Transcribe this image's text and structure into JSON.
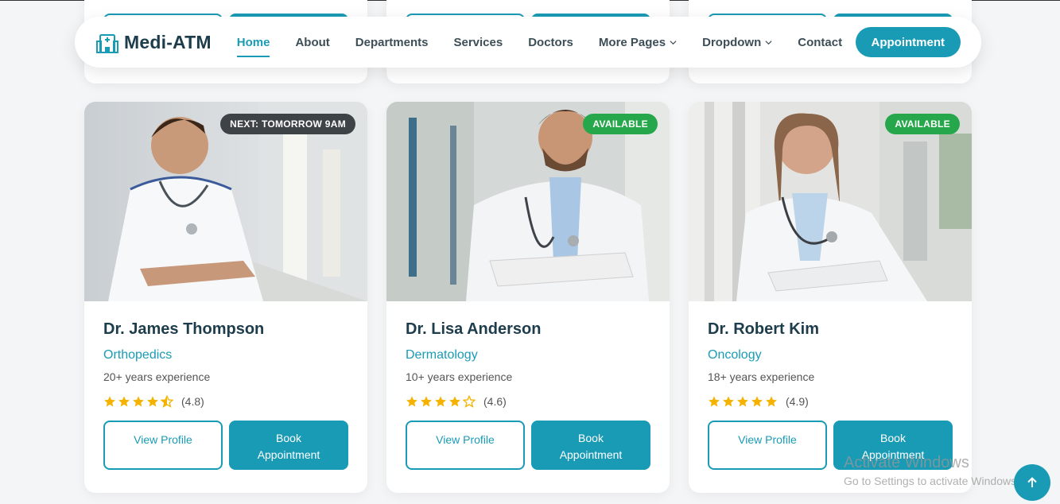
{
  "brand": {
    "name": "Medi-ATM"
  },
  "nav": {
    "items": [
      {
        "label": "Home",
        "active": true
      },
      {
        "label": "About"
      },
      {
        "label": "Departments"
      },
      {
        "label": "Services"
      },
      {
        "label": "Doctors"
      },
      {
        "label": "More Pages",
        "dropdown": true
      },
      {
        "label": "Dropdown",
        "dropdown": true
      },
      {
        "label": "Contact"
      }
    ],
    "cta": "Appointment"
  },
  "doctors": [
    {
      "name": "Dr. James Thompson",
      "specialty": "Orthopedics",
      "experience": "20+ years experience",
      "rating": "(4.8)",
      "stars": 4.5,
      "badge": "NEXT: TOMORROW 9AM",
      "badge_color": "#3e4347",
      "view_label": "View Profile",
      "book_label": "Book Appointment"
    },
    {
      "name": "Dr. Lisa Anderson",
      "specialty": "Dermatology",
      "experience": "10+ years experience",
      "rating": "(4.6)",
      "stars": 4,
      "badge": "AVAILABLE",
      "badge_color": "#27a74b",
      "view_label": "View Profile",
      "book_label": "Book Appointment"
    },
    {
      "name": "Dr. Robert Kim",
      "specialty": "Oncology",
      "experience": "18+ years experience",
      "rating": "(4.9)",
      "stars": 5,
      "badge": "AVAILABLE",
      "badge_color": "#27a74b",
      "view_label": "View Profile",
      "book_label": "Book Appointment"
    }
  ],
  "watermark": {
    "line1": "Activate Windows",
    "line2": "Go to Settings to activate Windows."
  },
  "colors": {
    "accent": "#1a9bb5",
    "heading": "#1d3d4c",
    "star": "#f5b301"
  },
  "icons": {
    "logo": "hospital-icon",
    "scroll": "arrow-up-icon",
    "chevron": "chevron-down-icon",
    "star": "star-icon"
  }
}
